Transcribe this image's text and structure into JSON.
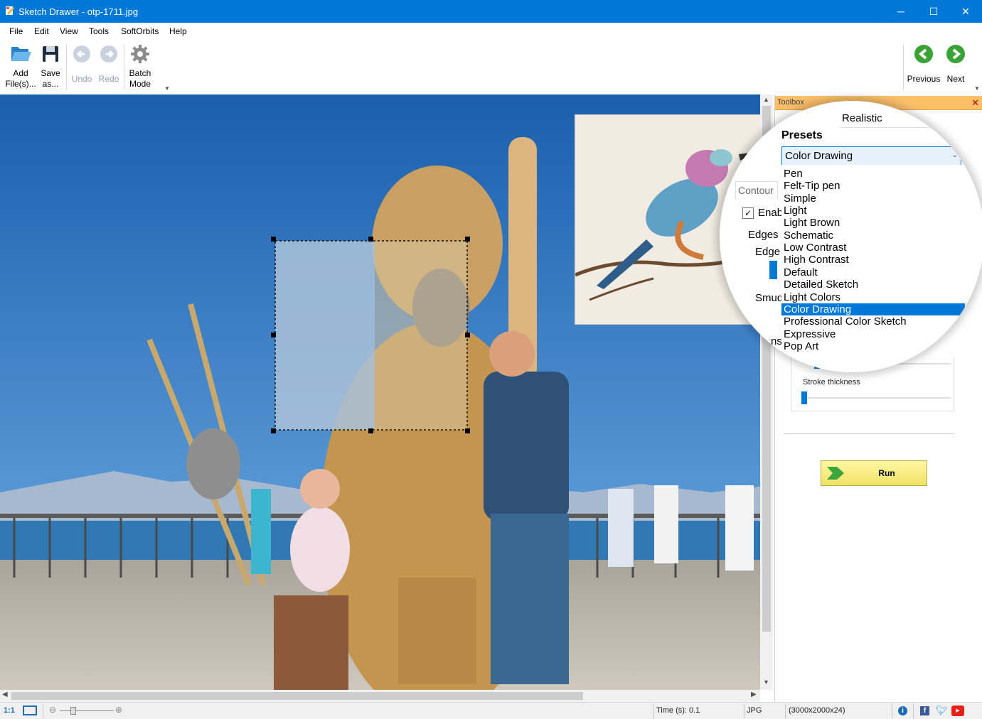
{
  "window": {
    "title": "Sketch Drawer - otp-1711.jpg"
  },
  "menu": [
    "File",
    "Edit",
    "View",
    "Tools",
    "SoftOrbits",
    "Help"
  ],
  "toolbar": {
    "add_files": [
      "Add",
      "File(s)..."
    ],
    "save_as": [
      "Save",
      "as..."
    ],
    "undo": "Undo",
    "redo": "Redo",
    "batch_mode": [
      "Batch",
      "Mode"
    ],
    "previous": "Previous",
    "next": "Next"
  },
  "toolbox": {
    "title": "Toolbox",
    "style_combo": "Realistic",
    "presets_label": "Presets",
    "presets_combo": "Color Drawing",
    "preset_options": [
      "Pen",
      "Felt-Tip pen",
      "Simple",
      "Light",
      "Light Brown",
      "Schematic",
      "Low Contrast",
      "High Contrast",
      "Default",
      "Detailed Sketch",
      "Light Colors",
      "Color Drawing",
      "Professional Color Sketch",
      "Expressive",
      "Pop Art"
    ],
    "selected_preset": "Color Drawing",
    "contour_tab": "Contour",
    "enable_label": "Enab",
    "enable_checked": true,
    "edges_label": "Edges",
    "edge_label": "Edge",
    "smudge_label": "Smud",
    "partial_label": "ns",
    "stroke_thickness_label": "Stroke thickness",
    "run_label": "Run"
  },
  "status": {
    "zoom_label": "1:1",
    "time": "Time (s): 0.1",
    "format": "JPG",
    "dims": "(3000x2000x24)"
  },
  "colors": {
    "titlebar": "#0078d7",
    "selection": "#0078d7",
    "toolbox_header": "#fbbf6a",
    "run_button": "#f2e166",
    "nav_arrow": "#3aa335"
  },
  "icons": [
    "app-icon",
    "folder-open-icon",
    "save-disk-icon",
    "undo-arrow-icon",
    "redo-arrow-icon",
    "gear-icon",
    "previous-arrow-icon",
    "next-arrow-icon",
    "run-arrow-icon",
    "info-icon",
    "facebook-icon",
    "twitter-icon",
    "youtube-icon"
  ]
}
